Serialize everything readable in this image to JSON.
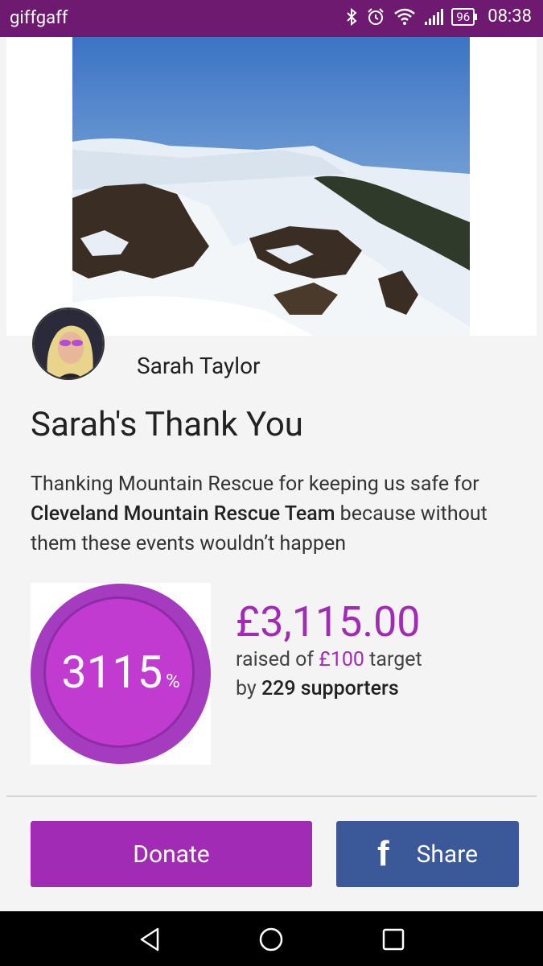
{
  "status_bar": {
    "carrier": "giffgaff",
    "battery": "96",
    "time": "08:38"
  },
  "campaign": {
    "fundraiser_name": "Sarah Taylor",
    "title": "Sarah's Thank You",
    "description_pre": "Thanking Mountain Rescue for keeping us safe for ",
    "charity": "Cleveland Mountain Rescue Team",
    "description_post": " because without them these events wouldn’t happen",
    "percent": "3115",
    "percent_sign": "%",
    "amount_raised": "£3,115.00",
    "raised_label": "raised of ",
    "target": "£100",
    "target_suffix": " target",
    "by_label": "by ",
    "supporters": "229 supporters"
  },
  "actions": {
    "donate_label": "Donate",
    "share_label": "Share",
    "facebook_glyph": "f"
  },
  "colors": {
    "status_bar": "#6e1a70",
    "accent": "#a22bb6",
    "facebook": "#3b5998"
  },
  "icons": [
    "bluetooth-icon",
    "alarm-icon",
    "wifi-icon",
    "signal-icon",
    "battery-icon",
    "back-icon",
    "home-icon",
    "recents-icon",
    "facebook-icon"
  ]
}
